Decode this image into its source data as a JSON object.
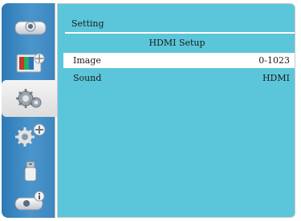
{
  "menu": {
    "title": "Setting",
    "submenu_title": "HDMI Setup",
    "rows": [
      {
        "label": "Image",
        "value": "0-1023",
        "selected": true
      },
      {
        "label": "Sound",
        "value": "HDMI",
        "selected": false
      }
    ]
  },
  "sidebar": {
    "items": [
      {
        "icon": "display-icon"
      },
      {
        "icon": "picture-adjust-icon"
      },
      {
        "icon": "setting-gears-icon",
        "selected": true
      },
      {
        "icon": "expanded-setting-icon"
      },
      {
        "icon": "usb-memory-icon"
      },
      {
        "icon": "information-icon"
      }
    ]
  },
  "colors": {
    "sidebar": "#3f88c2",
    "panel": "#5bc6d9",
    "selection": "#ffffff"
  }
}
